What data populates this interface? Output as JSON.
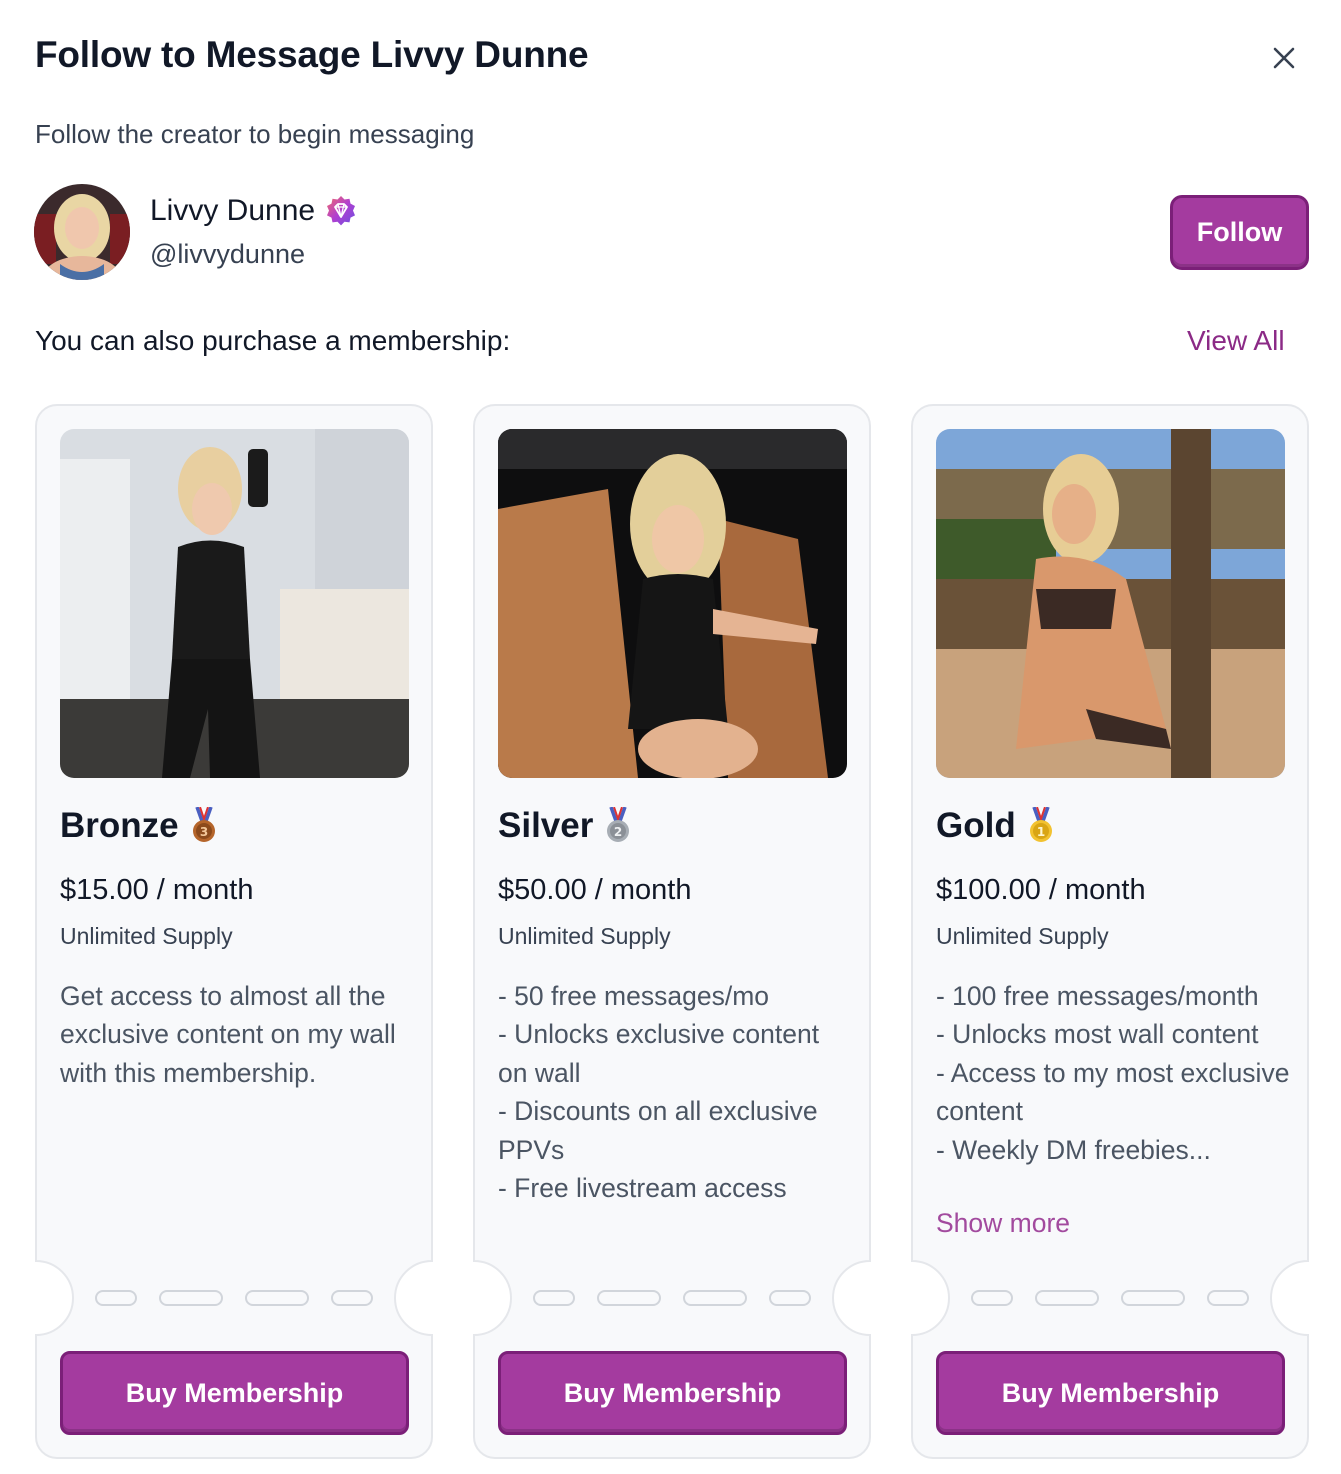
{
  "dialog": {
    "title": "Follow to Message Livvy Dunne",
    "subtitle": "Follow the creator to begin messaging",
    "close_icon": "close-icon"
  },
  "creator": {
    "name": "Livvy Dunne",
    "handle": "@livvydunne",
    "badge_icon": "diamond-verified-icon",
    "follow_label": "Follow"
  },
  "memberships": {
    "heading": "You can also purchase a membership:",
    "view_all": "View All",
    "tiers": [
      {
        "name": "Bronze",
        "medal_icon": "bronze-medal-icon",
        "price": "$15.00 / month",
        "supply": "Unlimited Supply",
        "description": "Get access to almost all the exclusive content on my wall with this membership.",
        "show_more": "",
        "button": "Buy Membership"
      },
      {
        "name": "Silver",
        "medal_icon": "silver-medal-icon",
        "price": "$50.00 / month",
        "supply": "Unlimited Supply",
        "description": "- 50 free messages/mo\n- Unlocks exclusive content on wall\n- Discounts on all exclusive PPVs\n- Free livestream access",
        "show_more": "",
        "button": "Buy Membership"
      },
      {
        "name": "Gold",
        "medal_icon": "gold-medal-icon",
        "price": "$100.00 / month",
        "supply": "Unlimited Supply",
        "description": "- 100 free messages/month\n- Unlocks most wall content\n- Access to my most exclusive content\n- Weekly DM freebies...",
        "show_more": "Show more",
        "button": "Buy Membership"
      }
    ]
  },
  "colors": {
    "accent": "#a43b9f",
    "accent_border": "#7b1f78",
    "link": "#8b2a86",
    "card_bg": "#f8f9fb",
    "card_border": "#e5e7eb"
  }
}
